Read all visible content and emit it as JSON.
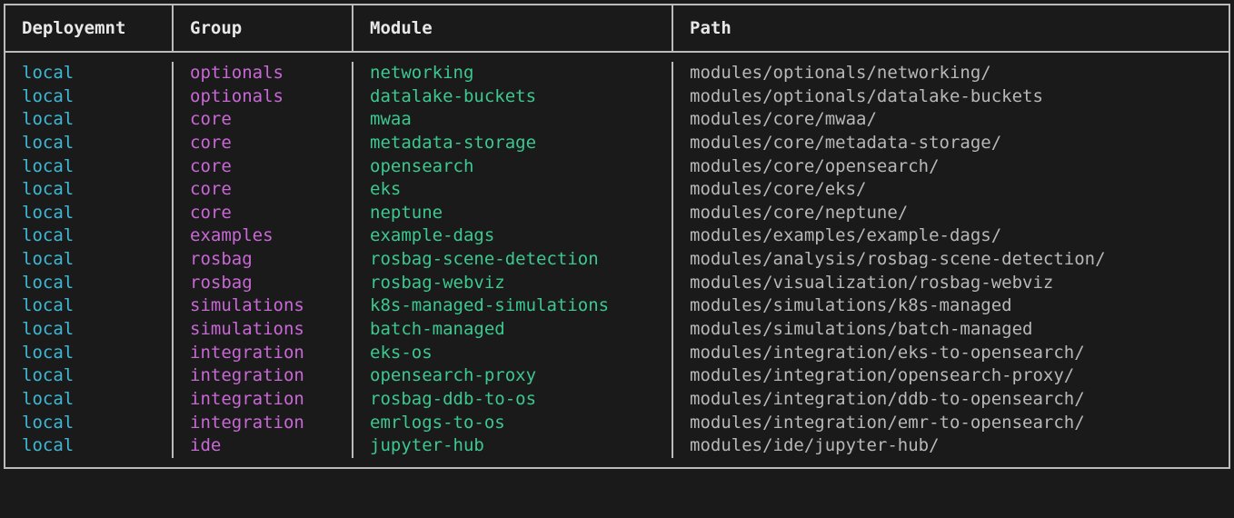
{
  "headers": {
    "deployment": "Deployemnt",
    "group": "Group",
    "module": "Module",
    "path": "Path"
  },
  "rows": [
    {
      "deployment": "local",
      "group": "optionals",
      "module": "networking",
      "path": "modules/optionals/networking/"
    },
    {
      "deployment": "local",
      "group": "optionals",
      "module": "datalake-buckets",
      "path": "modules/optionals/datalake-buckets"
    },
    {
      "deployment": "local",
      "group": "core",
      "module": "mwaa",
      "path": "modules/core/mwaa/"
    },
    {
      "deployment": "local",
      "group": "core",
      "module": "metadata-storage",
      "path": "modules/core/metadata-storage/"
    },
    {
      "deployment": "local",
      "group": "core",
      "module": "opensearch",
      "path": "modules/core/opensearch/"
    },
    {
      "deployment": "local",
      "group": "core",
      "module": "eks",
      "path": "modules/core/eks/"
    },
    {
      "deployment": "local",
      "group": "core",
      "module": "neptune",
      "path": "modules/core/neptune/"
    },
    {
      "deployment": "local",
      "group": "examples",
      "module": "example-dags",
      "path": "modules/examples/example-dags/"
    },
    {
      "deployment": "local",
      "group": "rosbag",
      "module": "rosbag-scene-detection",
      "path": "modules/analysis/rosbag-scene-detection/"
    },
    {
      "deployment": "local",
      "group": "rosbag",
      "module": "rosbag-webviz",
      "path": "modules/visualization/rosbag-webviz"
    },
    {
      "deployment": "local",
      "group": "simulations",
      "module": "k8s-managed-simulations",
      "path": "modules/simulations/k8s-managed"
    },
    {
      "deployment": "local",
      "group": "simulations",
      "module": "batch-managed",
      "path": "modules/simulations/batch-managed"
    },
    {
      "deployment": "local",
      "group": "integration",
      "module": "eks-os",
      "path": "modules/integration/eks-to-opensearch/"
    },
    {
      "deployment": "local",
      "group": "integration",
      "module": "opensearch-proxy",
      "path": "modules/integration/opensearch-proxy/"
    },
    {
      "deployment": "local",
      "group": "integration",
      "module": "rosbag-ddb-to-os",
      "path": "modules/integration/ddb-to-opensearch/"
    },
    {
      "deployment": "local",
      "group": "integration",
      "module": "emrlogs-to-os",
      "path": "modules/integration/emr-to-opensearch/"
    },
    {
      "deployment": "local",
      "group": "ide",
      "module": "jupyter-hub",
      "path": "modules/ide/jupyter-hub/"
    }
  ]
}
